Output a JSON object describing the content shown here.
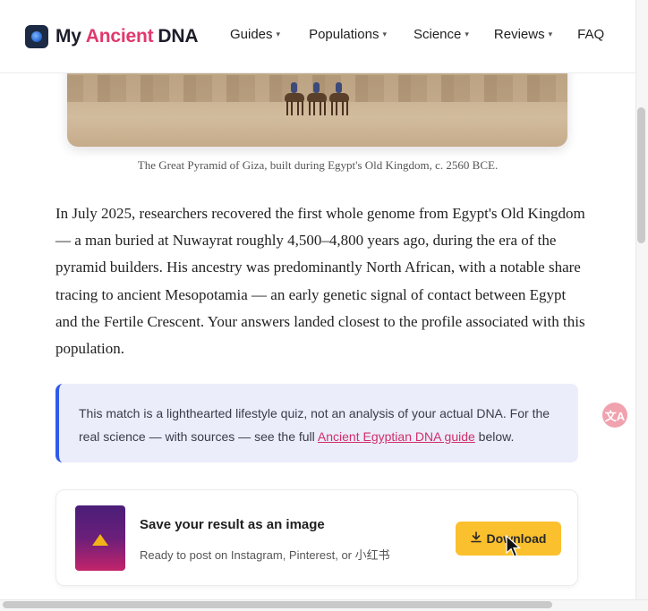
{
  "header": {
    "logo": {
      "word1": "My",
      "word2": "Ancient",
      "word3": "DNA",
      "accent_color": "#e0396d",
      "icon": "dna-globe-icon"
    },
    "nav": [
      {
        "label": "Guides",
        "has_dropdown": true
      },
      {
        "label": "Populations",
        "has_dropdown": true
      },
      {
        "label": "Science",
        "has_dropdown": true
      },
      {
        "label": "Reviews",
        "has_dropdown": true
      },
      {
        "label": "FAQ",
        "has_dropdown": false
      }
    ],
    "caret_glyph": "▾"
  },
  "hero": {
    "caption": "The Great Pyramid of Giza, built during Egypt's Old Kingdom, c. 2560 BCE."
  },
  "article": {
    "paragraph": "In July 2025, researchers recovered the first whole genome from Egypt's Old Kingdom — a man buried at Nuwayrat roughly 4,500–4,800 years ago, during the era of the pyramid builders. His ancestry was predominantly North African, with a notable share tracing to ancient Mesopotamia — an early genetic signal of contact between Egypt and the Fertile Crescent. Your answers landed closest to the profile associated with this population."
  },
  "notice": {
    "text_before": "This match is a lighthearted lifestyle quiz, not an analysis of your actual DNA. For the real science — with sources — see the full ",
    "link_text": "Ancient Egyptian DNA guide",
    "text_after": " below.",
    "border_color": "#2f5be7",
    "background_color": "#ebedfb"
  },
  "save_card": {
    "title": "Save your result as an image",
    "subtitle": "Ready to post on Instagram, Pinterest, or 小红书",
    "button_label": "Download",
    "button_icon": "download-icon",
    "button_color": "#fbc02d"
  },
  "floating": {
    "icon": "translate-icon",
    "glyph": "文A"
  }
}
